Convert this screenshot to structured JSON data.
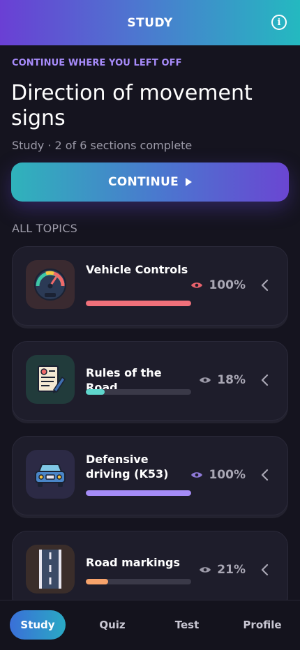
{
  "header": {
    "title": "STUDY",
    "info_icon": "info-icon"
  },
  "resume": {
    "eyebrow": "CONTINUE WHERE YOU LEFT OFF",
    "title": "Direction of movement signs",
    "progress": "Study · 2 of 6 sections complete",
    "button_label": "CONTINUE"
  },
  "topics_label": "ALL TOPICS",
  "topics": [
    {
      "name": "Vehicle Controls",
      "percent": "100%",
      "progress": 1.0,
      "bar_color": "#f0707a",
      "eye_color": "#e8626c",
      "icon": "speedometer-icon",
      "tile_color": "#3a2a30"
    },
    {
      "name": "Rules of the Road",
      "percent": "18%",
      "progress": 0.18,
      "bar_color": "#5fd6cc",
      "eye_color": "#9c9aa8",
      "icon": "document-pen-icon",
      "tile_color": "#213b3b"
    },
    {
      "name": "Defensive driving (K53)",
      "percent": "100%",
      "progress": 1.0,
      "bar_color": "#a58cf7",
      "eye_color": "#8f7ad8",
      "icon": "car-icon",
      "tile_color": "#2c2a45"
    },
    {
      "name": "Road markings",
      "percent": "21%",
      "progress": 0.21,
      "bar_color": "#f7a36b",
      "eye_color": "#9c9aa8",
      "icon": "road-icon",
      "tile_color": "#3a2d2a"
    }
  ],
  "tabs": [
    "Study",
    "Quiz",
    "Test",
    "Profile"
  ],
  "active_tab": "Study"
}
